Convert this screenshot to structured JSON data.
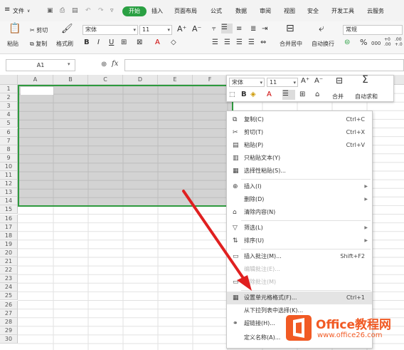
{
  "menubar": {
    "menu_icon": "≡",
    "file": "文件",
    "tabs": [
      "开始",
      "插入",
      "页面布局",
      "公式",
      "数据",
      "审阅",
      "视图",
      "安全",
      "开发工具",
      "云服务"
    ]
  },
  "ribbon": {
    "paste": "粘贴",
    "cut": "剪切",
    "copy": "复制",
    "format_painter": "格式刷",
    "font_name": "宋体",
    "font_size": "11",
    "bold": "B",
    "italic": "I",
    "underline": "U",
    "merge": "合并居中",
    "wrap": "自动换行",
    "number_format": "常规",
    "percent": "%",
    "thousands": "000",
    "dec_add": "+0\n.00",
    "dec_remove": ".00\n+.0"
  },
  "formula_bar": {
    "name_box": "A1",
    "fx": "fx"
  },
  "grid": {
    "columns": [
      "A",
      "B",
      "C",
      "D",
      "E",
      "F"
    ],
    "rows": [
      "1",
      "2",
      "3",
      "4",
      "5",
      "6",
      "7",
      "8",
      "9",
      "10",
      "11",
      "12",
      "13",
      "14",
      "15",
      "16",
      "17",
      "18",
      "19",
      "20",
      "21",
      "22",
      "23",
      "24",
      "25",
      "26",
      "27",
      "28",
      "29",
      "30"
    ]
  },
  "mini_toolbar": {
    "font_name": "宋体",
    "font_size": "11",
    "bold": "B",
    "merge": "合并",
    "autosum": "自动求和"
  },
  "context_menu": {
    "items": [
      {
        "icon": "copy-icon",
        "label": "复制(C)",
        "shortcut": "Ctrl+C"
      },
      {
        "icon": "scissors-icon",
        "label": "剪切(T)",
        "shortcut": "Ctrl+X"
      },
      {
        "icon": "paste-icon",
        "label": "粘贴(P)",
        "shortcut": "Ctrl+V"
      },
      {
        "icon": "paste-text-icon",
        "label": "只粘贴文本(Y)",
        "shortcut": ""
      },
      {
        "icon": "paste-special-icon",
        "label": "选择性粘贴(S)...",
        "shortcut": ""
      },
      {
        "icon": "insert-icon",
        "label": "插入(I)",
        "shortcut": ""
      },
      {
        "icon": "",
        "label": "删除(D)",
        "shortcut": ""
      },
      {
        "icon": "eraser-icon",
        "label": "清除内容(N)",
        "shortcut": ""
      },
      {
        "icon": "filter-icon",
        "label": "筛选(L)",
        "shortcut": ""
      },
      {
        "icon": "sort-icon",
        "label": "排序(U)",
        "shortcut": ""
      },
      {
        "icon": "comment-icon",
        "label": "插入批注(M)...",
        "shortcut": "Shift+F2"
      },
      {
        "icon": "",
        "label": "编辑批注(E)...",
        "shortcut": ""
      },
      {
        "icon": "comment-delete-icon",
        "label": "删除批注(M)",
        "shortcut": ""
      },
      {
        "icon": "format-cells-icon",
        "label": "设置单元格格式(F)...",
        "shortcut": "Ctrl+1"
      },
      {
        "icon": "",
        "label": "从下拉列表中选择(K)...",
        "shortcut": ""
      },
      {
        "icon": "link-icon",
        "label": "超链接(H)...",
        "shortcut": ""
      },
      {
        "icon": "",
        "label": "定义名称(A)...",
        "shortcut": ""
      }
    ]
  },
  "watermark": {
    "brand": "Office教程网",
    "url": "www.office26.com"
  },
  "colors": {
    "accent": "#2aa043",
    "selection_border": "#2e9a3e",
    "arrow": "#e02020",
    "logo_orange": "#f15a24"
  }
}
